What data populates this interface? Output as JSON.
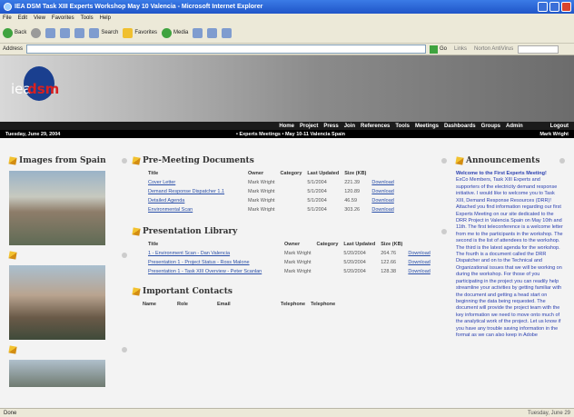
{
  "window": {
    "title": "IEA DSM Task XIII Experts Workshop May 10 Valencia - Microsoft Internet Explorer"
  },
  "menu": [
    "File",
    "Edit",
    "View",
    "Favorites",
    "Tools",
    "Help"
  ],
  "toolbar": {
    "back": "Back",
    "search": "Search",
    "favorites": "Favorites",
    "media": "Media"
  },
  "address": {
    "label": "Address",
    "go": "Go",
    "links": "Links",
    "norton": "Norton AntiVirus"
  },
  "logo": {
    "prefix": "iea",
    "suffix": "dsm"
  },
  "nav": [
    "Home",
    "Project",
    "Press",
    "Join",
    "References",
    "Tools",
    "Meetings",
    "Dashboards",
    "Groups",
    "Admin"
  ],
  "nav_logout": "Logout",
  "subbar": {
    "date": "Tuesday, June 29, 2004",
    "crumb": "• Experts Meetings • May 10-11 Valencia Spain",
    "user": "Mark Wright"
  },
  "left": {
    "title": "Images from Spain"
  },
  "premeeting": {
    "title": "Pre-Meeting Documents",
    "headers": [
      "Title",
      "Owner",
      "Category",
      "Last Updated",
      "Size (KB)",
      ""
    ],
    "rows": [
      [
        "Cover Letter",
        "Mark Wright",
        "",
        "5/1/2004",
        "221.39",
        "Download"
      ],
      [
        "Demand Response Dispatcher 1.1",
        "Mark Wright",
        "",
        "5/1/2004",
        "120.89",
        "Download"
      ],
      [
        "Detailed Agenda",
        "Mark Wright",
        "",
        "5/1/2004",
        "46.59",
        "Download"
      ],
      [
        "Environmental Scan",
        "Mark Wright",
        "",
        "5/1/2004",
        "303.26",
        "Download"
      ]
    ]
  },
  "library": {
    "title": "Presentation Library",
    "headers": [
      "Title",
      "Owner",
      "Category",
      "Last Updated",
      "Size (KB)",
      ""
    ],
    "rows": [
      [
        "1 - Environment Scan - Dan Valencia",
        "Mark Wright",
        "",
        "5/20/2004",
        "264.76",
        "Download"
      ],
      [
        "Presentation 1 - Project Status - Ross Malone",
        "Mark Wright",
        "",
        "5/20/2004",
        "122.66",
        "Download"
      ],
      [
        "Presentation 1 - Task XIII Overview - Peter Scanlan",
        "Mark Wright",
        "",
        "5/20/2004",
        "128.38",
        "Download"
      ]
    ]
  },
  "contacts": {
    "title": "Important Contacts",
    "headers": [
      "Name",
      "Role",
      "Email",
      "Telephone",
      "Telephone"
    ]
  },
  "announcements": {
    "title": "Announcements",
    "heading": "Welcome to the First Experts Meeting!",
    "body": "ExCo Members, Task XIII Experts and supporters of the electricity demand response initiative. I would like to welcome you to Task XIII, Demand Response Resources (DRR)! Attached you find information regarding our first Experts Meeting on our site dedicated to the DRR Project in Valencia Spain on May 10th and 11th. The first teleconference is a welcome letter from me to the participants in the workshop. The second is the list of attendees to the workshop. The third is the latest agenda for the workshop. The fourth is a document called the DRR Dispatcher and on to the Technical and Organizational issues that we will be working on during the workshop. For those of you participating in the project you can readily help streamline your activities by getting familiar with the document and getting a head start on beginning the data being requested. The document will provide the project team with the key information we need to move onto much of the analytical work of the project. Let us know if you have any trouble saving information in the format as we can also keep in Adobe"
  },
  "status": {
    "left": "Done",
    "right": "Tuesday, June 29"
  }
}
